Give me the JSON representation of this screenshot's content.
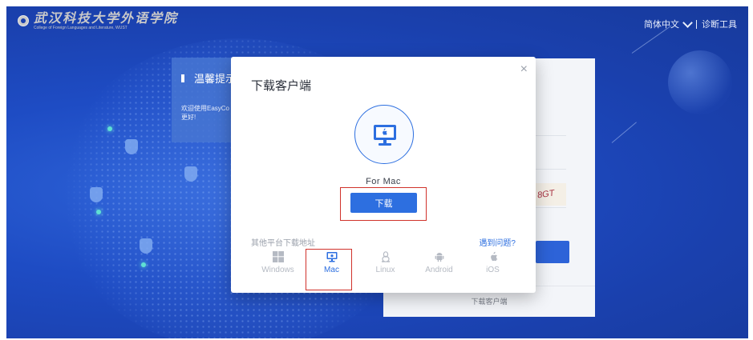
{
  "header": {
    "logo_cn": "武汉科技大学外语学院",
    "logo_en": "College of Foreign Languages and Literature, WUST",
    "language": "简体中文",
    "diagnostic": "诊断工具"
  },
  "notice": {
    "title": "温馨提示",
    "line1": "欢迎使用EasyCo",
    "line2": "更好!"
  },
  "captcha_text": "8GT",
  "login_footer": "下载客户端",
  "modal": {
    "title": "下载客户端",
    "close": "×",
    "platform_name": "For Mac",
    "download_button": "下载",
    "other_platforms_label": "其他平台下载地址",
    "help_link": "遇到问题?",
    "platforms": [
      {
        "label": "Windows",
        "icon": "windows-icon",
        "active": false
      },
      {
        "label": "Mac",
        "icon": "mac-monitor-icon",
        "active": true
      },
      {
        "label": "Linux",
        "icon": "linux-icon",
        "active": false
      },
      {
        "label": "Android",
        "icon": "android-icon",
        "active": false
      },
      {
        "label": "iOS",
        "icon": "apple-icon",
        "active": false
      }
    ]
  },
  "colors": {
    "background": "#1e4cc4",
    "accent": "#2d6fe0",
    "highlight": "#d0322b"
  }
}
